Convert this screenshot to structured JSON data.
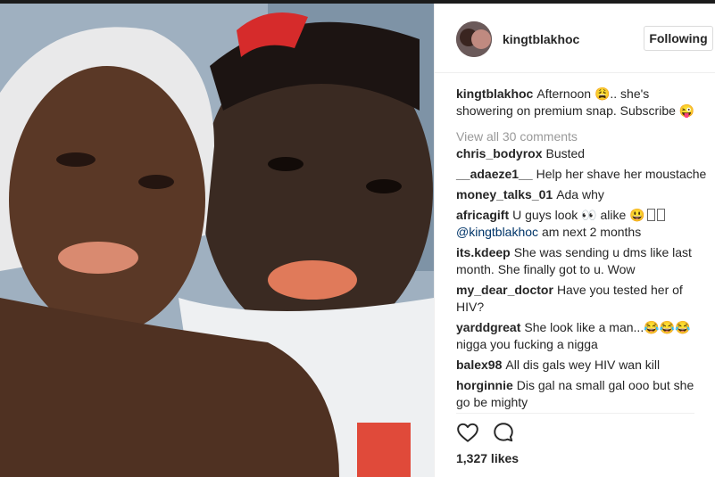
{
  "post": {
    "username": "kingtblakhoc",
    "follow_label": "Following"
  },
  "caption": {
    "user": "kingtblakhoc",
    "text": "Afternoon 😩.. she's showering on premium snap. Subscribe 😜"
  },
  "view_all_comments": "View all 30 comments",
  "comments": [
    {
      "user": "chris_bodyrox",
      "text": "Busted"
    },
    {
      "user": "__adaeze1__",
      "text": "Help her shave her moustache"
    },
    {
      "user": "money_talks_01",
      "text": "Ada why"
    },
    {
      "user": "africagift",
      "text": "U guys look 👀 alike 😃",
      "mention": "@kingtblakhoc",
      "after": "am next 2 months"
    },
    {
      "user": "its.kdeep",
      "text": "She was sending u dms like last month. She finally got to u. Wow"
    },
    {
      "user": "my_dear_doctor",
      "text": "Have you tested her of HIV?"
    },
    {
      "user": "yarddgreat",
      "text": "She look like a man...😂😂😂 nigga you fucking a nigga"
    },
    {
      "user": "balex98",
      "text": "All dis gals wey HIV wan kill"
    },
    {
      "user": "horginnie",
      "text": "Dis gal na small gal ooo but she go be mighty"
    }
  ],
  "actions": {
    "like_icon": "heart-icon",
    "comment_icon": "comment-icon"
  },
  "likes": "1,327 likes",
  "colors": {
    "text": "#262626",
    "muted": "#999999",
    "border": "#efefef",
    "mention": "#003569"
  }
}
